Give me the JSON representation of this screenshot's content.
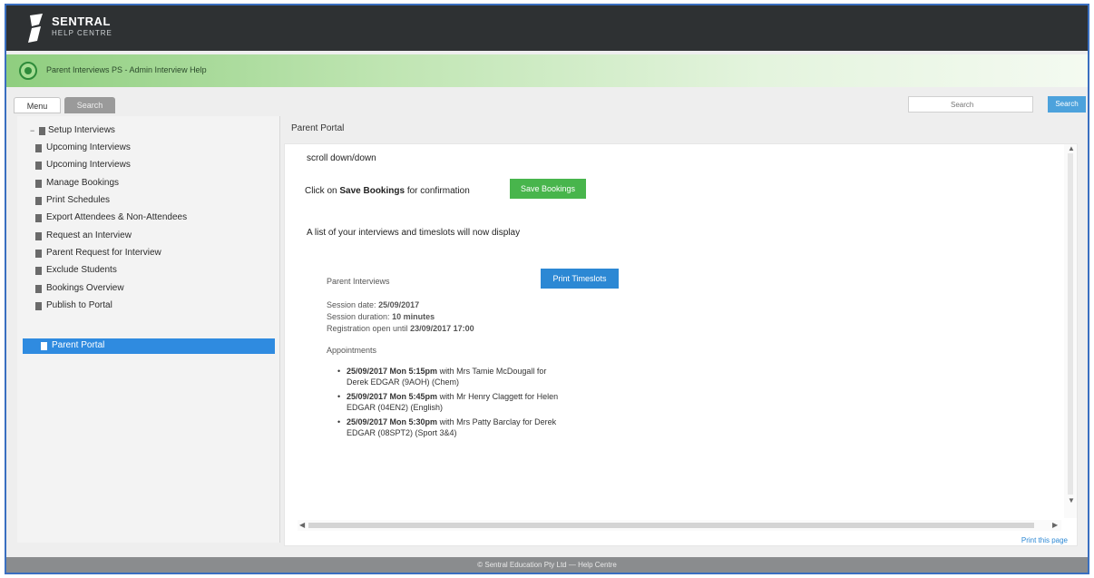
{
  "header": {
    "logo_title": "SENTRAL",
    "logo_subtitle": "HELP CENTRE"
  },
  "breadcrumb": {
    "part1": "",
    "part2": "",
    "part3": "Parent Interviews PS - Admin Interview Help"
  },
  "tabs": {
    "menu": "Menu",
    "search": "Search"
  },
  "search": {
    "placeholder": "Search",
    "button": "Search"
  },
  "sidebar": {
    "items": [
      {
        "label": "Setup Interviews",
        "toggle": "−"
      },
      {
        "label": "Upcoming Interviews"
      },
      {
        "label": "Upcoming Interviews"
      },
      {
        "label": "Manage Bookings"
      },
      {
        "label": "Print Schedules"
      },
      {
        "label": "Export Attendees & Non-Attendees"
      },
      {
        "label": "Request an Interview"
      },
      {
        "label": "Parent Request for Interview"
      },
      {
        "label": "Exclude Students"
      },
      {
        "label": "Bookings Overview"
      },
      {
        "label": "Publish to Portal"
      },
      {
        "label": "Parent Portal"
      }
    ]
  },
  "content": {
    "title": "Parent Portal",
    "scroll_text": "scroll down/down",
    "click_on": "Click on",
    "save_bookings_bold": "Save Bookings",
    "for_confirmation": "for confirmation",
    "save_bookings_button": "Save Bookings",
    "list_text": "A list of your interviews and timeslots will now display",
    "interview_name": "Parent Interviews",
    "print_timeslots_button": "Print Timeslots",
    "session_date_label": "Session date:",
    "session_date_value": "25/09/2017",
    "session_duration_label": "Session duration:",
    "session_duration_value": "10 minutes",
    "registration_label": "Registration open until",
    "registration_value": "23/09/2017 17:00",
    "appointments_label": "Appointments",
    "appointments": [
      {
        "bold": "25/09/2017 Mon 5:15pm",
        "line1": " with Mrs Tamie McDougall for",
        "line2": "Derek EDGAR (9AOH) (Chem)"
      },
      {
        "bold": "25/09/2017 Mon 5:45pm",
        "line1": " with Mr Henry Claggett for Helen",
        "line2": "EDGAR (04EN2) (English)"
      },
      {
        "bold": "25/09/2017 Mon 5:30pm",
        "line1": " with Mrs Patty Barclay for Derek",
        "line2": "EDGAR (08SPT2) (Sport 3&4)"
      }
    ],
    "print_link": "Print this page"
  },
  "footer": {
    "text": "© Sentral Education Pty Ltd — Help Centre"
  },
  "colors": {
    "header": "#2e3133",
    "accent_blue": "#2f8be0",
    "accent_green": "#48b54c"
  }
}
